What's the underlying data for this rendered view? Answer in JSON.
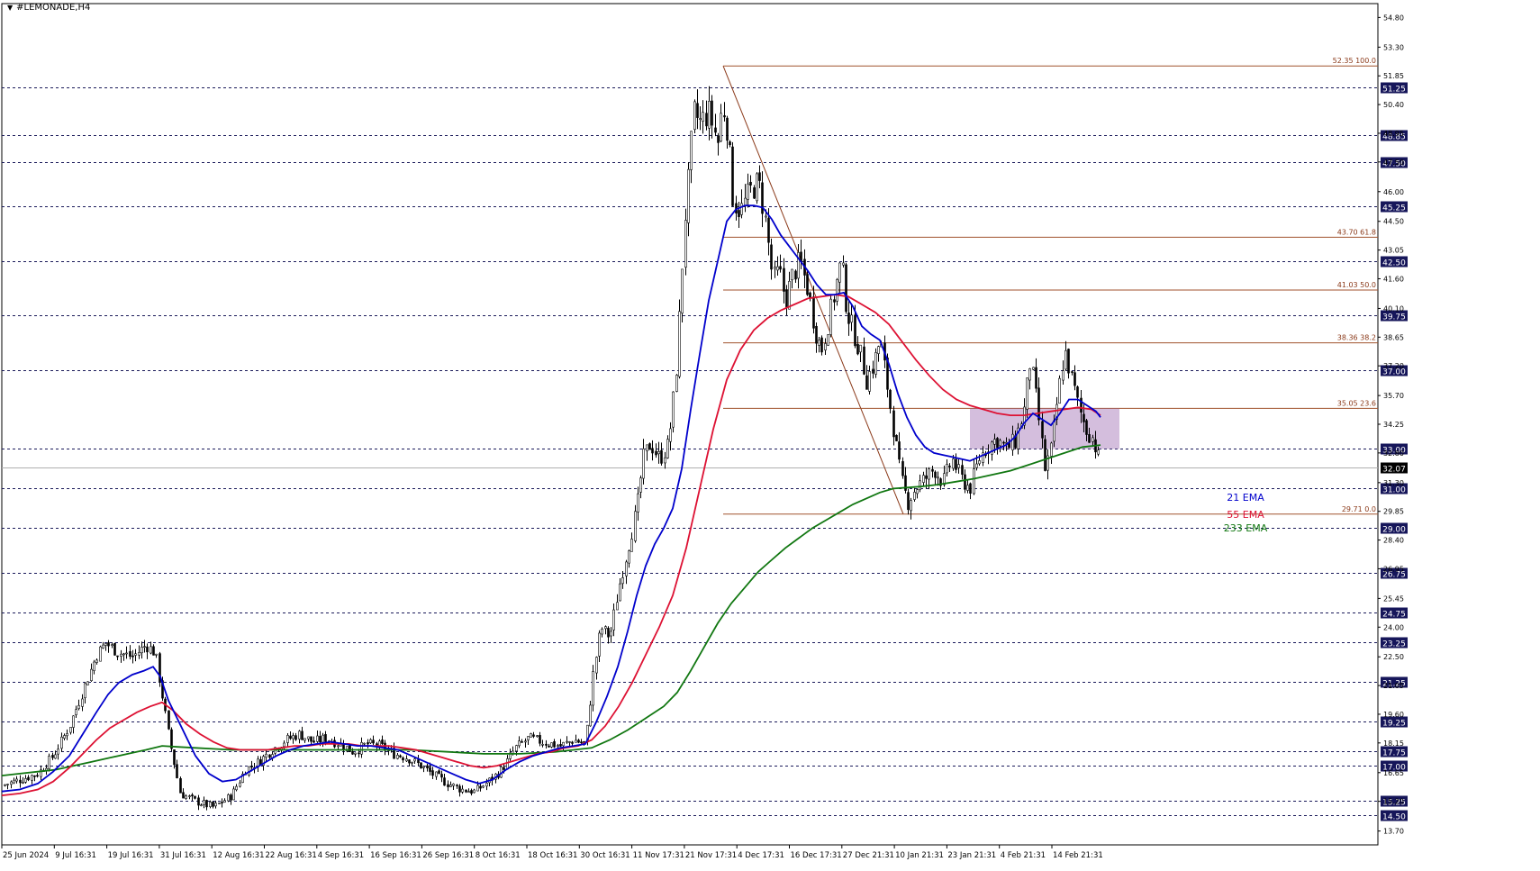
{
  "window_title": "#LEMONADE,H4",
  "chart_data": {
    "type": "candlestick",
    "symbol": "#LEMONADE",
    "timeframe": "H4",
    "ylim": [
      13.0,
      55.5
    ],
    "x_tick_labels": [
      "25 Jun 2024",
      "9 Jul 16:31",
      "19 Jul 16:31",
      "31 Jul 16:31",
      "12 Aug 16:31",
      "22 Aug 16:31",
      "4 Sep 16:31",
      "16 Sep 16:31",
      "26 Sep 16:31",
      "8 Oct 16:31",
      "18 Oct 16:31",
      "30 Oct 16:31",
      "11 Nov 17:31",
      "21 Nov 17:31",
      "4 Dec 17:31",
      "16 Dec 17:31",
      "27 Dec 21:31",
      "10 Jan 21:31",
      "23 Jan 21:31",
      "4 Feb 21:31",
      "14 Feb 21:31"
    ],
    "y_tick_labels": [
      "54.80",
      "53.30",
      "51.85",
      "50.40",
      "48.95",
      "47.50",
      "46.00",
      "44.50",
      "43.05",
      "41.60",
      "40.10",
      "38.65",
      "37.20",
      "35.70",
      "34.25",
      "32.80",
      "31.30",
      "29.85",
      "28.40",
      "26.95",
      "25.45",
      "24.00",
      "22.50",
      "21.05",
      "19.60",
      "18.15",
      "16.65",
      "15.20",
      "13.70"
    ],
    "highlighted_levels": [
      "51.25",
      "48.85",
      "47.50",
      "45.25",
      "42.50",
      "39.75",
      "37.00",
      "33.00",
      "31.00",
      "29.00",
      "26.75",
      "24.75",
      "23.25",
      "21.25",
      "19.25",
      "17.75",
      "17.00",
      "15.25",
      "14.50"
    ],
    "current_price": "32.07",
    "fibonacci": {
      "high": 52.35,
      "low": 29.71,
      "levels": [
        {
          "label": "52.35 100.0",
          "value": 52.35
        },
        {
          "label": "43.70 61.8",
          "value": 43.7
        },
        {
          "label": "41.03 50.0",
          "value": 41.03
        },
        {
          "label": "38.36 38.2",
          "value": 38.36
        },
        {
          "label": "35.05 23.6",
          "value": 35.05
        },
        {
          "label": "29.71 0.0",
          "value": 29.71
        }
      ]
    },
    "zone": {
      "top": 35.05,
      "bottom": 33.0
    },
    "legend": [
      {
        "label": "21 EMA",
        "color": "#0000cc"
      },
      {
        "label": "55 EMA",
        "color": "#dd1133"
      },
      {
        "label": "233 EMA",
        "color": "#117711"
      }
    ],
    "price_path": [
      [
        0,
        16.0
      ],
      [
        20,
        16.3
      ],
      [
        40,
        16.6
      ],
      [
        57,
        17.5
      ],
      [
        75,
        19.0
      ],
      [
        90,
        20.8
      ],
      [
        105,
        22.6
      ],
      [
        115,
        23.2
      ],
      [
        130,
        22.7
      ],
      [
        145,
        22.5
      ],
      [
        160,
        23.1
      ],
      [
        170,
        22.7
      ],
      [
        178,
        20.5
      ],
      [
        185,
        18.5
      ],
      [
        198,
        15.6
      ],
      [
        215,
        15.2
      ],
      [
        235,
        14.9
      ],
      [
        255,
        15.5
      ],
      [
        270,
        16.8
      ],
      [
        285,
        17.2
      ],
      [
        300,
        17.8
      ],
      [
        315,
        18.3
      ],
      [
        330,
        18.6
      ],
      [
        345,
        18.2
      ],
      [
        360,
        18.4
      ],
      [
        375,
        18.1
      ],
      [
        390,
        17.7
      ],
      [
        405,
        18.1
      ],
      [
        420,
        18.0
      ],
      [
        435,
        17.6
      ],
      [
        450,
        17.4
      ],
      [
        465,
        17.0
      ],
      [
        480,
        16.5
      ],
      [
        495,
        16.1
      ],
      [
        510,
        15.8
      ],
      [
        525,
        15.7
      ],
      [
        540,
        16.2
      ],
      [
        555,
        16.8
      ],
      [
        570,
        17.9
      ],
      [
        585,
        18.4
      ],
      [
        600,
        18.2
      ],
      [
        620,
        18.0
      ],
      [
        635,
        18.3
      ],
      [
        648,
        18.1
      ],
      [
        656,
        21.5
      ],
      [
        665,
        24.0
      ],
      [
        675,
        23.5
      ],
      [
        685,
        26.0
      ],
      [
        695,
        28.0
      ],
      [
        705,
        30.0
      ],
      [
        712,
        32.5
      ],
      [
        720,
        33.3
      ],
      [
        730,
        32.5
      ],
      [
        740,
        33.2
      ],
      [
        748,
        36.5
      ],
      [
        752,
        39.5
      ],
      [
        758,
        44.5
      ],
      [
        763,
        47.0
      ],
      [
        768,
        50.0
      ],
      [
        775,
        49.5
      ],
      [
        785,
        50.0
      ],
      [
        795,
        48.5
      ],
      [
        800,
        50.5
      ],
      [
        806,
        49.0
      ],
      [
        812,
        45.5
      ],
      [
        820,
        45.0
      ],
      [
        830,
        46.0
      ],
      [
        840,
        46.5
      ],
      [
        848,
        44.5
      ],
      [
        856,
        41.5
      ],
      [
        863,
        42.0
      ],
      [
        870,
        40.5
      ],
      [
        878,
        41.8
      ],
      [
        886,
        42.5
      ],
      [
        895,
        41.0
      ],
      [
        903,
        39.0
      ],
      [
        910,
        38.0
      ],
      [
        918,
        39.5
      ],
      [
        925,
        41.0
      ],
      [
        932,
        42.5
      ],
      [
        938,
        40.0
      ],
      [
        945,
        39.0
      ],
      [
        952,
        38.0
      ],
      [
        960,
        36.5
      ],
      [
        968,
        37.3
      ],
      [
        975,
        38.5
      ],
      [
        982,
        36.5
      ],
      [
        990,
        34.0
      ],
      [
        998,
        31.5
      ],
      [
        1006,
        30.3
      ],
      [
        1014,
        31.0
      ],
      [
        1025,
        31.5
      ],
      [
        1035,
        32.0
      ],
      [
        1045,
        31.3
      ],
      [
        1055,
        32.5
      ],
      [
        1065,
        31.5
      ],
      [
        1075,
        31.0
      ],
      [
        1085,
        32.5
      ],
      [
        1095,
        33.2
      ],
      [
        1105,
        33.5
      ],
      [
        1115,
        33.0
      ],
      [
        1125,
        33.4
      ],
      [
        1135,
        35.0
      ],
      [
        1142,
        37.5
      ],
      [
        1150,
        35.0
      ],
      [
        1158,
        32.0
      ],
      [
        1165,
        33.0
      ],
      [
        1172,
        35.5
      ],
      [
        1180,
        38.0
      ],
      [
        1188,
        36.5
      ],
      [
        1196,
        35.0
      ],
      [
        1204,
        34.0
      ],
      [
        1212,
        33.5
      ],
      [
        1220,
        32.1
      ]
    ],
    "ema21": [
      [
        0,
        15.7
      ],
      [
        20,
        15.8
      ],
      [
        40,
        16.1
      ],
      [
        57,
        16.7
      ],
      [
        75,
        17.5
      ],
      [
        90,
        18.6
      ],
      [
        105,
        19.7
      ],
      [
        118,
        20.6
      ],
      [
        130,
        21.2
      ],
      [
        145,
        21.6
      ],
      [
        158,
        21.8
      ],
      [
        168,
        22.0
      ],
      [
        176,
        21.5
      ],
      [
        185,
        20.3
      ],
      [
        200,
        18.9
      ],
      [
        215,
        17.5
      ],
      [
        230,
        16.6
      ],
      [
        245,
        16.2
      ],
      [
        260,
        16.3
      ],
      [
        275,
        16.7
      ],
      [
        290,
        17.1
      ],
      [
        305,
        17.5
      ],
      [
        320,
        17.8
      ],
      [
        335,
        18.0
      ],
      [
        350,
        18.1
      ],
      [
        365,
        18.2
      ],
      [
        380,
        18.1
      ],
      [
        395,
        18.0
      ],
      [
        410,
        18.0
      ],
      [
        425,
        17.9
      ],
      [
        440,
        17.8
      ],
      [
        455,
        17.5
      ],
      [
        470,
        17.2
      ],
      [
        485,
        16.9
      ],
      [
        500,
        16.6
      ],
      [
        515,
        16.3
      ],
      [
        530,
        16.1
      ],
      [
        545,
        16.3
      ],
      [
        560,
        16.8
      ],
      [
        575,
        17.2
      ],
      [
        590,
        17.5
      ],
      [
        605,
        17.7
      ],
      [
        620,
        17.9
      ],
      [
        635,
        18.0
      ],
      [
        648,
        18.1
      ],
      [
        660,
        19.2
      ],
      [
        672,
        20.5
      ],
      [
        684,
        22.0
      ],
      [
        695,
        23.8
      ],
      [
        705,
        25.6
      ],
      [
        715,
        27.1
      ],
      [
        725,
        28.2
      ],
      [
        735,
        29.0
      ],
      [
        745,
        30.0
      ],
      [
        755,
        32.0
      ],
      [
        765,
        35.0
      ],
      [
        775,
        37.8
      ],
      [
        785,
        40.5
      ],
      [
        795,
        42.5
      ],
      [
        805,
        44.5
      ],
      [
        815,
        45.1
      ],
      [
        825,
        45.3
      ],
      [
        835,
        45.3
      ],
      [
        845,
        45.2
      ],
      [
        855,
        44.6
      ],
      [
        865,
        43.8
      ],
      [
        875,
        43.2
      ],
      [
        885,
        42.6
      ],
      [
        895,
        42.0
      ],
      [
        905,
        41.3
      ],
      [
        915,
        40.8
      ],
      [
        925,
        40.8
      ],
      [
        935,
        40.9
      ],
      [
        945,
        40.2
      ],
      [
        955,
        39.2
      ],
      [
        965,
        38.8
      ],
      [
        975,
        38.5
      ],
      [
        985,
        37.3
      ],
      [
        995,
        35.8
      ],
      [
        1005,
        34.6
      ],
      [
        1015,
        33.7
      ],
      [
        1025,
        33.1
      ],
      [
        1035,
        32.8
      ],
      [
        1045,
        32.7
      ],
      [
        1055,
        32.6
      ],
      [
        1065,
        32.5
      ],
      [
        1075,
        32.4
      ],
      [
        1085,
        32.6
      ],
      [
        1095,
        32.8
      ],
      [
        1105,
        33.0
      ],
      [
        1115,
        33.2
      ],
      [
        1125,
        33.6
      ],
      [
        1135,
        34.3
      ],
      [
        1145,
        34.8
      ],
      [
        1155,
        34.5
      ],
      [
        1165,
        34.2
      ],
      [
        1175,
        34.8
      ],
      [
        1185,
        35.5
      ],
      [
        1195,
        35.5
      ],
      [
        1205,
        35.2
      ],
      [
        1215,
        34.9
      ],
      [
        1220,
        34.6
      ]
    ],
    "ema55": [
      [
        0,
        15.5
      ],
      [
        20,
        15.6
      ],
      [
        40,
        15.8
      ],
      [
        57,
        16.2
      ],
      [
        75,
        16.9
      ],
      [
        90,
        17.6
      ],
      [
        105,
        18.3
      ],
      [
        120,
        18.9
      ],
      [
        135,
        19.3
      ],
      [
        150,
        19.7
      ],
      [
        165,
        20.0
      ],
      [
        178,
        20.2
      ],
      [
        190,
        19.8
      ],
      [
        205,
        19.1
      ],
      [
        220,
        18.6
      ],
      [
        235,
        18.2
      ],
      [
        250,
        17.9
      ],
      [
        265,
        17.8
      ],
      [
        280,
        17.8
      ],
      [
        295,
        17.8
      ],
      [
        310,
        17.9
      ],
      [
        325,
        18.0
      ],
      [
        340,
        18.0
      ],
      [
        355,
        18.1
      ],
      [
        370,
        18.1
      ],
      [
        385,
        18.1
      ],
      [
        400,
        18.0
      ],
      [
        415,
        18.0
      ],
      [
        430,
        18.0
      ],
      [
        445,
        17.9
      ],
      [
        460,
        17.8
      ],
      [
        475,
        17.6
      ],
      [
        490,
        17.4
      ],
      [
        505,
        17.2
      ],
      [
        520,
        17.0
      ],
      [
        535,
        16.9
      ],
      [
        550,
        17.0
      ],
      [
        565,
        17.2
      ],
      [
        580,
        17.4
      ],
      [
        595,
        17.6
      ],
      [
        610,
        17.7
      ],
      [
        625,
        17.9
      ],
      [
        640,
        18.0
      ],
      [
        655,
        18.3
      ],
      [
        670,
        19.0
      ],
      [
        685,
        20.0
      ],
      [
        700,
        21.2
      ],
      [
        715,
        22.6
      ],
      [
        730,
        24.0
      ],
      [
        745,
        25.6
      ],
      [
        760,
        28.0
      ],
      [
        775,
        31.0
      ],
      [
        790,
        34.0
      ],
      [
        805,
        36.5
      ],
      [
        820,
        38.0
      ],
      [
        835,
        39.0
      ],
      [
        850,
        39.6
      ],
      [
        865,
        40.0
      ],
      [
        880,
        40.3
      ],
      [
        895,
        40.6
      ],
      [
        910,
        40.7
      ],
      [
        925,
        40.8
      ],
      [
        940,
        40.7
      ],
      [
        955,
        40.3
      ],
      [
        970,
        39.9
      ],
      [
        985,
        39.3
      ],
      [
        1000,
        38.4
      ],
      [
        1015,
        37.5
      ],
      [
        1030,
        36.7
      ],
      [
        1045,
        36.0
      ],
      [
        1060,
        35.5
      ],
      [
        1075,
        35.2
      ],
      [
        1090,
        35.0
      ],
      [
        1105,
        34.8
      ],
      [
        1120,
        34.7
      ],
      [
        1135,
        34.7
      ],
      [
        1150,
        34.8
      ],
      [
        1165,
        34.9
      ],
      [
        1180,
        35.0
      ],
      [
        1195,
        35.1
      ],
      [
        1210,
        35.0
      ],
      [
        1220,
        34.7
      ]
    ],
    "ema233": [
      [
        0,
        16.5
      ],
      [
        20,
        16.6
      ],
      [
        40,
        16.7
      ],
      [
        60,
        16.8
      ],
      [
        80,
        17.0
      ],
      [
        100,
        17.2
      ],
      [
        120,
        17.4
      ],
      [
        140,
        17.6
      ],
      [
        160,
        17.8
      ],
      [
        178,
        18.0
      ],
      [
        195,
        17.95
      ],
      [
        215,
        17.9
      ],
      [
        235,
        17.85
      ],
      [
        255,
        17.8
      ],
      [
        275,
        17.8
      ],
      [
        295,
        17.8
      ],
      [
        315,
        17.8
      ],
      [
        335,
        17.8
      ],
      [
        355,
        17.8
      ],
      [
        375,
        17.8
      ],
      [
        395,
        17.8
      ],
      [
        415,
        17.8
      ],
      [
        435,
        17.8
      ],
      [
        455,
        17.8
      ],
      [
        475,
        17.75
      ],
      [
        495,
        17.7
      ],
      [
        515,
        17.65
      ],
      [
        535,
        17.6
      ],
      [
        555,
        17.6
      ],
      [
        575,
        17.6
      ],
      [
        595,
        17.65
      ],
      [
        615,
        17.7
      ],
      [
        635,
        17.8
      ],
      [
        655,
        17.9
      ],
      [
        675,
        18.3
      ],
      [
        695,
        18.8
      ],
      [
        715,
        19.4
      ],
      [
        735,
        20.0
      ],
      [
        750,
        20.7
      ],
      [
        765,
        21.8
      ],
      [
        780,
        23.0
      ],
      [
        795,
        24.2
      ],
      [
        810,
        25.2
      ],
      [
        825,
        26.0
      ],
      [
        840,
        26.8
      ],
      [
        855,
        27.4
      ],
      [
        870,
        28.0
      ],
      [
        885,
        28.5
      ],
      [
        900,
        29.0
      ],
      [
        915,
        29.4
      ],
      [
        930,
        29.8
      ],
      [
        945,
        30.2
      ],
      [
        960,
        30.5
      ],
      [
        975,
        30.8
      ],
      [
        990,
        31.0
      ],
      [
        1005,
        31.05
      ],
      [
        1020,
        31.1
      ],
      [
        1040,
        31.2
      ],
      [
        1060,
        31.35
      ],
      [
        1080,
        31.5
      ],
      [
        1100,
        31.7
      ],
      [
        1120,
        31.9
      ],
      [
        1140,
        32.2
      ],
      [
        1160,
        32.5
      ],
      [
        1180,
        32.8
      ],
      [
        1200,
        33.1
      ],
      [
        1220,
        33.2
      ]
    ]
  }
}
